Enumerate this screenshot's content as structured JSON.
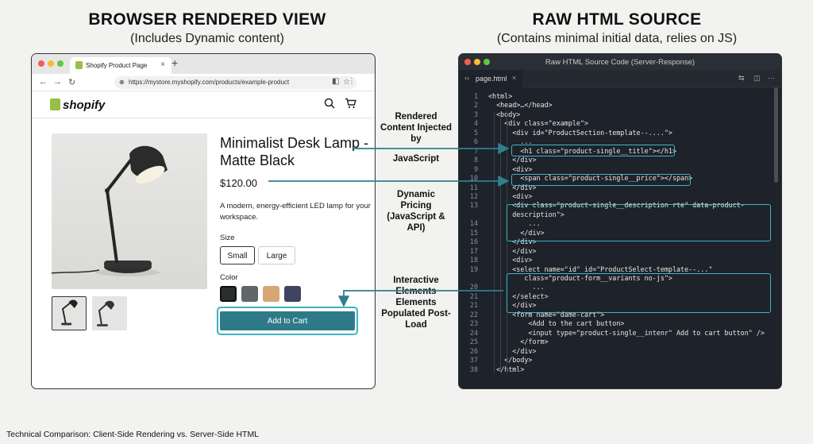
{
  "headings": {
    "left_title": "BROWSER RENDERED VIEW",
    "left_subtitle": "(Includes Dynamic content)",
    "right_title": "RAW HTML SOURCE",
    "right_subtitle": "(Contains minimal initial data, relies on JS)"
  },
  "browser": {
    "tab_title": "Shopify Product Page",
    "url": "https://mystore.myshopify.com/products/example-product",
    "logo_text": "shopify",
    "product_title": "Minimalist Desk Lamp - Matte Black",
    "price": "$120.00",
    "description": "A modern, energy-efficient LED lamp for your workspace.",
    "size_label": "Size",
    "sizes": [
      "Small",
      "Large"
    ],
    "color_label": "Color",
    "colors": [
      "#2b2e2f",
      "#5f6769",
      "#d6a773",
      "#3f4460"
    ],
    "cart_button": "Add to Cart"
  },
  "code": {
    "window_title": "Raw HTML Source Code (Server-Response)",
    "file_tab": "page.html",
    "lines": [
      {
        "n": "1",
        "t": "<html>"
      },
      {
        "n": "2",
        "t": "  <head>…</head>"
      },
      {
        "n": "3",
        "t": "  <body>"
      },
      {
        "n": "4",
        "t": "    <div class=\"example\">"
      },
      {
        "n": "5",
        "t": "      <div id=\"ProductSection-template--....\">"
      },
      {
        "n": "6",
        "t": "        ..."
      },
      {
        "n": "7",
        "t": "        <h1 class=\"product-single__title\"></h1>"
      },
      {
        "n": "8",
        "t": "      </div>"
      },
      {
        "n": "9",
        "t": "      <div>"
      },
      {
        "n": "10",
        "t": "        <span class=\"product-single__price\"></span>"
      },
      {
        "n": "11",
        "t": "      </div>"
      },
      {
        "n": "12",
        "t": "      <div>"
      },
      {
        "n": "13",
        "t": "      <div class=\"product-single__description rte\" data-product-"
      },
      {
        "n": "",
        "t": "      description\">"
      },
      {
        "n": "14",
        "t": "          ..."
      },
      {
        "n": "15",
        "t": "        </div>"
      },
      {
        "n": "16",
        "t": "      </div>"
      },
      {
        "n": "17",
        "t": "      </div>"
      },
      {
        "n": "18",
        "t": "      <div>"
      },
      {
        "n": "19",
        "t": "      <select name=\"id\" id=\"ProductSelect-template--...\""
      },
      {
        "n": "",
        "t": "         class=\"product-form__variants no-js\">"
      },
      {
        "n": "20",
        "t": "           ..."
      },
      {
        "n": "21",
        "t": "      </select>"
      },
      {
        "n": "21",
        "t": "      </div>"
      },
      {
        "n": "22",
        "t": "      <form name=\"dame-cart\">"
      },
      {
        "n": "23",
        "t": "          <Add to the cart button>"
      },
      {
        "n": "24",
        "t": "          <input type=\"product-single__intenr\" Add to cart button\" />"
      },
      {
        "n": "25",
        "t": "        </form>"
      },
      {
        "n": "26",
        "t": "      </div>"
      },
      {
        "n": "37",
        "t": "    </body>"
      },
      {
        "n": "38",
        "t": "  </html>"
      }
    ]
  },
  "annotations": {
    "rendered": "Rendered Content Injected by",
    "javascript": "JavaScript",
    "pricing": "Dynamic Pricing (JavaScript & API)",
    "interactive": "Interactive Elements Elements Populated Post-Load"
  },
  "footer": "Technical Comparison: Client-Side Rendering vs. Server-Side HTML"
}
